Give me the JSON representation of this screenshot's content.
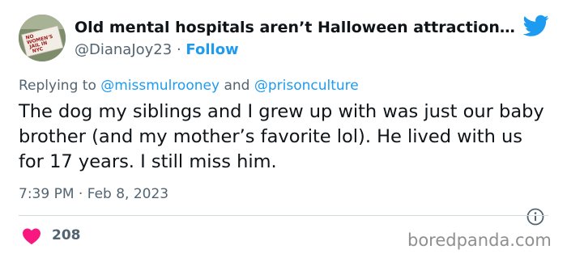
{
  "tweet": {
    "display_name": "Old mental hospitals aren’t Halloween attraction...",
    "handle": "@DianaJoy23",
    "separator": "·",
    "follow_label": "Follow",
    "replying_to_prefix": "Replying to",
    "replying_to_users": [
      "@missmulrooney",
      "@prisonculture"
    ],
    "replying_to_joiner": "and",
    "text": "The dog my siblings and I grew up with was just our baby brother (and my mother’s favorite lol). He lived with us for 17 years. I still miss him.",
    "time": "7:39 PM",
    "date": "Feb 8, 2023",
    "like_count": "208"
  },
  "avatar": {
    "sign_text": [
      "NO",
      "WOMEN'S",
      "JAIL IN",
      "NYC"
    ]
  },
  "watermark": "boredpanda.com",
  "icons": {
    "brand": "twitter-bird-icon",
    "like": "heart-icon",
    "info": "info-icon"
  },
  "colors": {
    "accent": "#1d9bf0",
    "like": "#f91880",
    "secondary_text": "#536471",
    "primary_text": "#0f1419",
    "divider": "#cfd9de",
    "watermark": "#8f8f8f"
  }
}
